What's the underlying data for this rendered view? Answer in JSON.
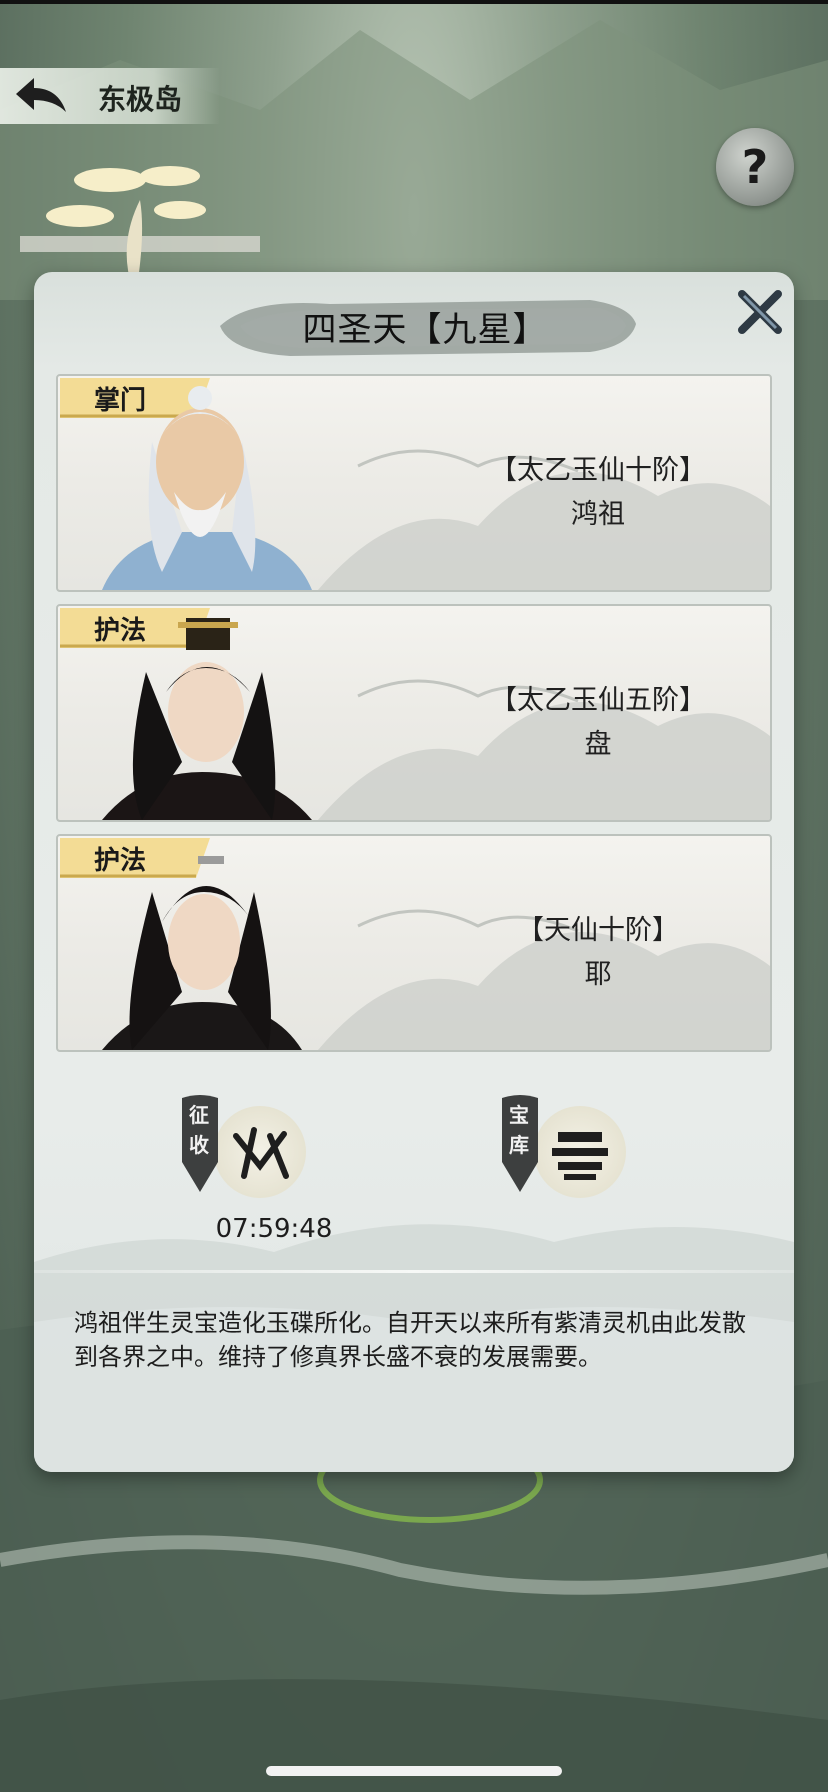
{
  "header": {
    "location": "东极岛",
    "back_icon": "back-arrow-icon",
    "help_icon": "question-mark-icon",
    "help_symbol": "?"
  },
  "dialog": {
    "title": "四圣天【九星】",
    "close_icon": "close-x-icon",
    "members": [
      {
        "role": "掌门",
        "rank": "【太乙玉仙十阶】",
        "name": "鸿祖",
        "portrait": "white-haired-elder-portrait"
      },
      {
        "role": "护法",
        "rank": "【太乙玉仙五阶】",
        "name": "盘",
        "portrait": "crowned-black-haired-man-portrait"
      },
      {
        "role": "护法",
        "rank": "【天仙十阶】",
        "name": "耶",
        "portrait": "black-haired-man-portrait"
      }
    ],
    "actions": [
      {
        "flag": [
          "征",
          "收"
        ],
        "icon": "collect-emblem-icon",
        "timer": "07:59:48"
      },
      {
        "flag": [
          "宝",
          "库"
        ],
        "icon": "treasury-emblem-icon"
      }
    ],
    "description": "鸿祖伴生灵宝造化玉碟所化。自开天以来所有紫清灵机由此发散到各界之中。维持了修真界长盛不衰的发展需要。"
  },
  "colors": {
    "tag_gold": "#f3dc95",
    "panel": "#e8ecea",
    "background_green": "#6f8470"
  }
}
